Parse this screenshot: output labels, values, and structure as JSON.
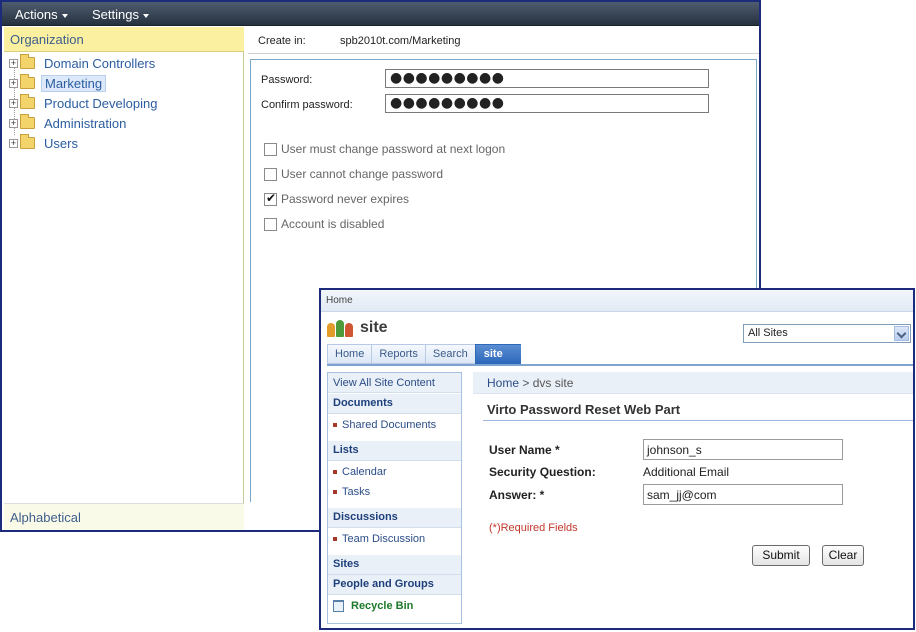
{
  "admin": {
    "menus": [
      {
        "label": "Actions"
      },
      {
        "label": "Settings"
      }
    ],
    "tree_header": "Organization",
    "tree_items": [
      {
        "label": "Domain Controllers"
      },
      {
        "label": "Marketing"
      },
      {
        "label": "Product Developing"
      },
      {
        "label": "Administration"
      },
      {
        "label": "Users"
      }
    ],
    "tree_footer": "Alphabetical",
    "create_in_label": "Create in:",
    "create_in_value": "spb2010t.com/Marketing",
    "password_label": "Password:",
    "password_value": "●●●●●●●●●",
    "confirm_label": "Confirm password:",
    "confirm_value": "●●●●●●●●●",
    "checkboxes": [
      {
        "label": "User must change password at next logon",
        "checked": false
      },
      {
        "label": "User cannot change password",
        "checked": false
      },
      {
        "label": "Password never expires",
        "checked": true
      },
      {
        "label": "Account is disabled",
        "checked": false
      }
    ]
  },
  "sharepoint": {
    "top_link": "Home",
    "site_title": "site",
    "scope_select": "All Sites",
    "tabs": [
      {
        "label": "Home"
      },
      {
        "label": "Reports"
      },
      {
        "label": "Search"
      },
      {
        "label": "site"
      }
    ],
    "quick_launch": {
      "view_all": "View All Site Content",
      "documents": "Documents",
      "shared_documents": "Shared Documents",
      "lists": "Lists",
      "calendar": "Calendar",
      "tasks": "Tasks",
      "discussions": "Discussions",
      "team_discussion": "Team Discussion",
      "sites": "Sites",
      "people_groups": "People and Groups",
      "recycle_bin": "Recycle Bin"
    },
    "breadcrumb_home": "Home",
    "breadcrumb_sep": " > ",
    "breadcrumb_current": "dvs site",
    "webpart_title": "Virto Password Reset Web Part",
    "username_label": "User Name *",
    "username_value": "johnson_s",
    "question_label": "Security Question:",
    "question_value": "Additional Email",
    "answer_label": "Answer: *",
    "answer_value": "sam_jj@com",
    "required_note": "(*)Required Fields",
    "submit_label": "Submit",
    "clear_label": "Clear"
  },
  "colors": {
    "window_border": "#1d2b7c",
    "menubar": "#26313f",
    "org_header_bg": "#fbf0a0",
    "link_blue": "#2b5da0",
    "active_tab": "#2d68bb",
    "required_red": "#c0392b",
    "recycle_green": "#1d7a2a"
  }
}
